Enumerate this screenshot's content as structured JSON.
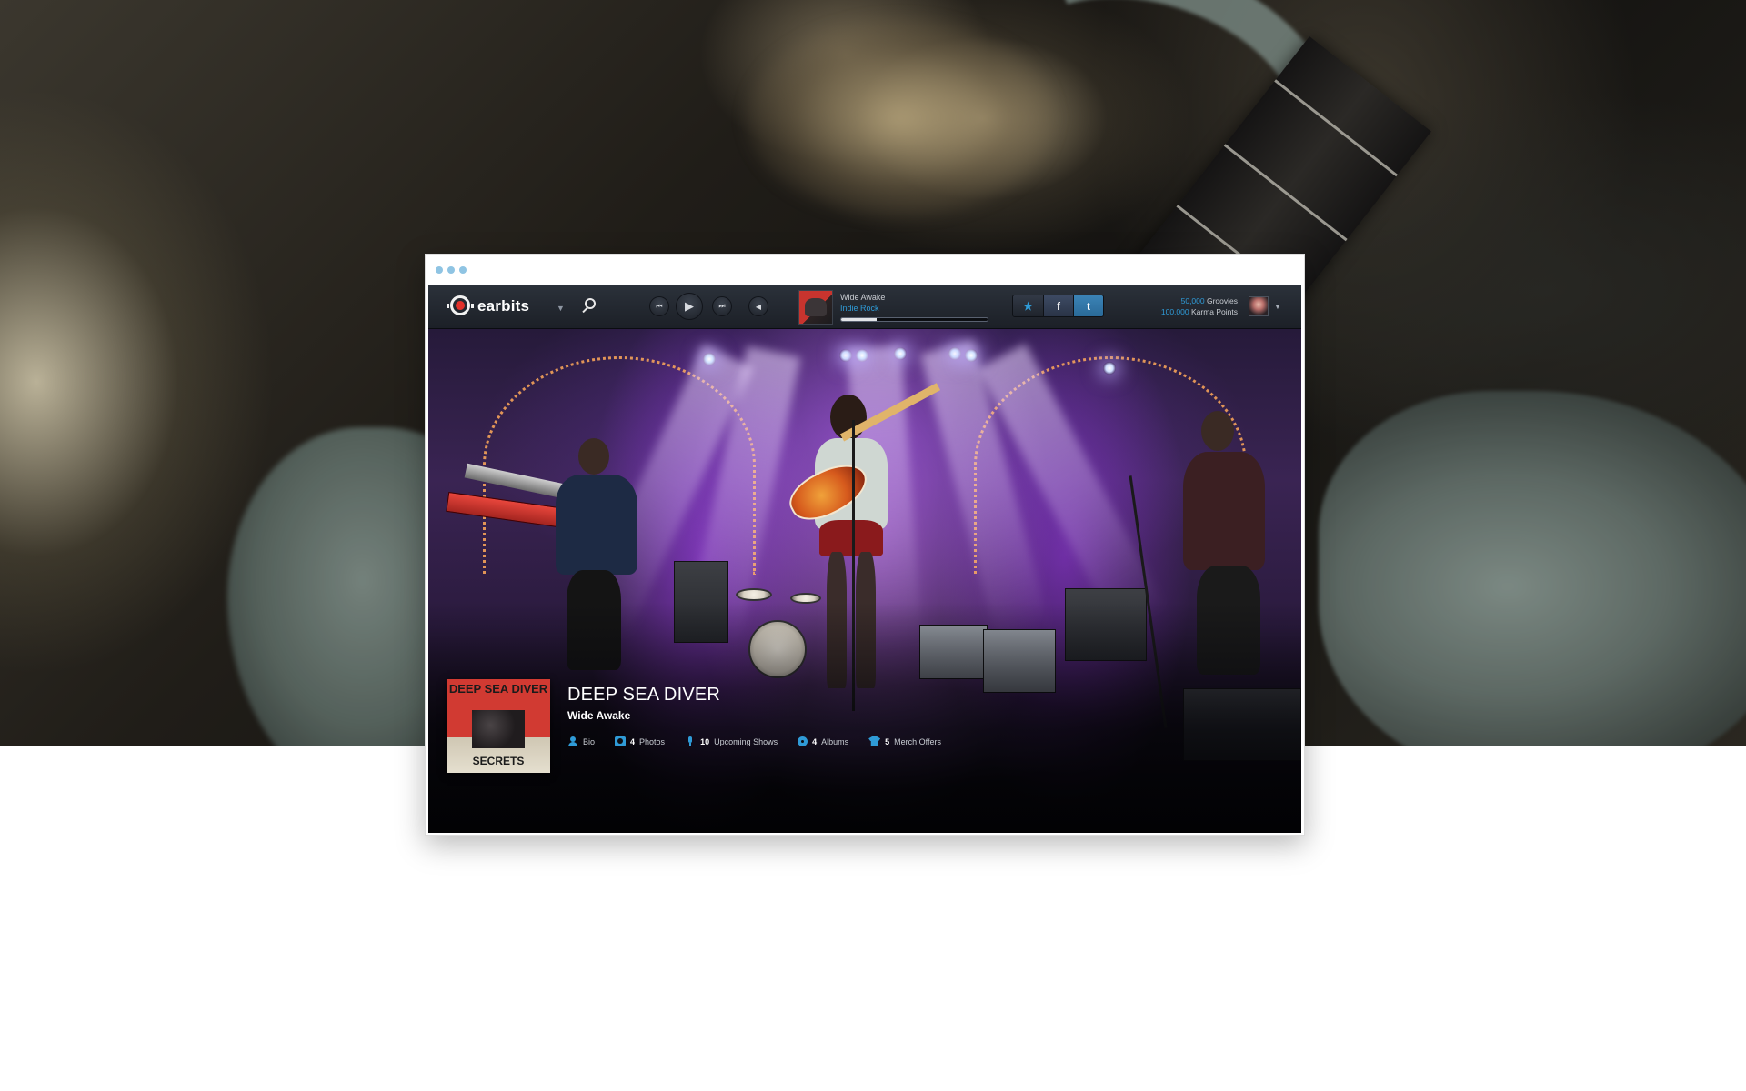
{
  "app": {
    "name": "earbits"
  },
  "player": {
    "track_title": "Wide Awake",
    "genre": "Indie Rock",
    "progress": 0.24
  },
  "user": {
    "groovies_count": "50,000",
    "groovies_label": "Groovies",
    "karma_count": "100,000",
    "karma_label": "Karma Points"
  },
  "artist": {
    "name": "DEEP SEA DIVER",
    "song": "Wide Awake",
    "album_art_top": "DEEP SEA DIVER",
    "album_art_bottom": "SECRETS"
  },
  "links": {
    "bio": "Bio",
    "photos_count": "4",
    "photos_label": "Photos",
    "shows_count": "10",
    "shows_label": "Upcoming Shows",
    "albums_count": "4",
    "albums_label": "Albums",
    "merch_count": "5",
    "merch_label": "Merch Offers"
  },
  "icons": {
    "logo": "earbits-logo-icon",
    "search": "search-icon",
    "prev": "previous-track-icon",
    "play": "play-icon",
    "next": "next-track-icon",
    "volume": "volume-icon",
    "favorite": "star-icon",
    "facebook": "facebook-icon",
    "twitter": "twitter-icon"
  },
  "colors": {
    "accent": "#2f9bd7",
    "window_dots": "#8fc4e3",
    "logo_red": "#e1312b"
  }
}
